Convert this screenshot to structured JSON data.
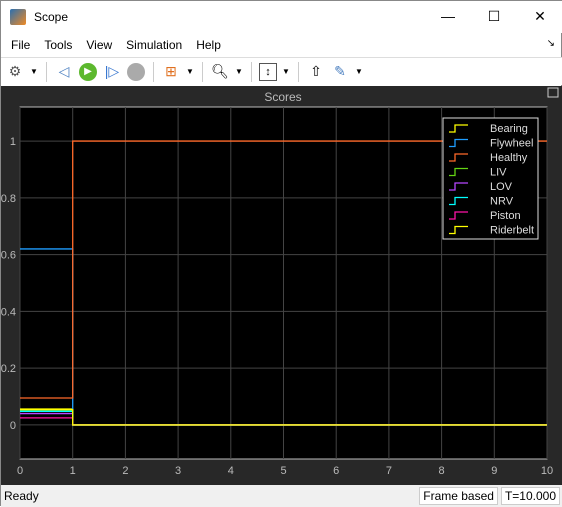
{
  "window": {
    "title": "Scope",
    "controls": [
      "—",
      "☐",
      "✕"
    ]
  },
  "menu": [
    "File",
    "Tools",
    "View",
    "Simulation",
    "Help"
  ],
  "toolbar": {
    "icons": [
      "gear-icon",
      "step-back-icon",
      "run-icon",
      "step-forward-icon",
      "stop-icon",
      "signal-selector-icon",
      "zoom-in-icon",
      "scale-axes-icon",
      "triggers-icon",
      "measurements-icon"
    ]
  },
  "status": {
    "text": "Ready",
    "mode": "Frame based",
    "time": "T=10.000"
  },
  "chart_data": {
    "type": "line",
    "title": "Scores",
    "xlabel": "",
    "ylabel": "",
    "xlim": [
      0,
      10
    ],
    "ylim": [
      -0.12,
      1.12
    ],
    "xticks": [
      "0",
      "1",
      "2",
      "3",
      "4",
      "5",
      "6",
      "7",
      "8",
      "9",
      "10"
    ],
    "yticks": [
      {
        "v": 0,
        "l": "0"
      },
      {
        "v": 0.2,
        "l": "0.2"
      },
      {
        "v": 0.4,
        "l": "0.4"
      },
      {
        "v": 0.6,
        "l": "0.6"
      },
      {
        "v": 0.8,
        "l": "0.8"
      },
      {
        "v": 1,
        "l": "1"
      }
    ],
    "grid": true,
    "legend_position": "top-right",
    "step": true,
    "x": [
      0,
      1,
      10
    ],
    "series": [
      {
        "name": "Bearing",
        "color": "#ffff00",
        "values": [
          0.056,
          0,
          0
        ]
      },
      {
        "name": "Flywheel",
        "color": "#1f9eff",
        "values": [
          0.62,
          0,
          0
        ]
      },
      {
        "name": "Healthy",
        "color": "#ff6929",
        "values": [
          0.095,
          1,
          1
        ]
      },
      {
        "name": "LIV",
        "color": "#64d413",
        "values": [
          0.052,
          0,
          0
        ]
      },
      {
        "name": "LOV",
        "color": "#b746ff",
        "values": [
          0.04,
          0,
          0
        ]
      },
      {
        "name": "NRV",
        "color": "#0ff",
        "values": [
          0.048,
          0,
          0
        ]
      },
      {
        "name": "Piston",
        "color": "#ff13a6",
        "values": [
          0.025,
          0,
          0
        ]
      },
      {
        "name": "Riderbelt",
        "color": "#ffff00",
        "values": [
          0.054,
          0,
          0
        ]
      }
    ]
  }
}
